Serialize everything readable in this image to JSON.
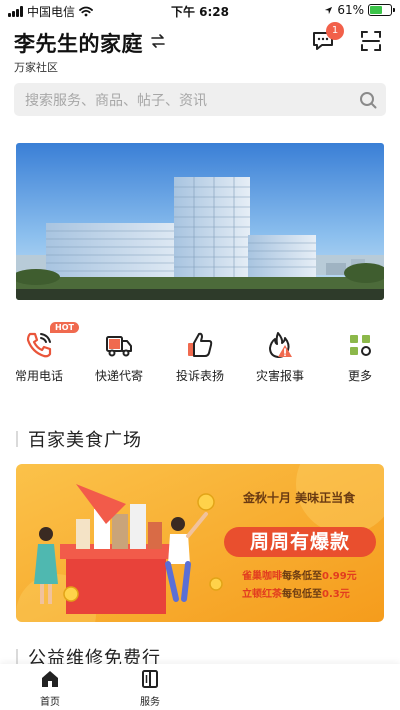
{
  "status_bar": {
    "carrier": "中国电信",
    "time": "下午 6:28",
    "battery": "61%",
    "battery_level": 0.61
  },
  "header": {
    "title": "李先生的家庭",
    "community": "万家社区",
    "message_badge": "1"
  },
  "search": {
    "placeholder": "搜索服务、商品、帖子、资讯"
  },
  "quick_menu": {
    "hot_tag": "HOT",
    "items": [
      {
        "label": "常用电话",
        "icon": "phone-icon"
      },
      {
        "label": "快递代寄",
        "icon": "delivery-truck-icon"
      },
      {
        "label": "投诉表扬",
        "icon": "thumbs-up-icon"
      },
      {
        "label": "灾害报事",
        "icon": "fire-warning-icon"
      },
      {
        "label": "更多",
        "icon": "grid-more-icon"
      }
    ]
  },
  "sections": {
    "food": "百家美食广场",
    "repair": "公益维修免费行"
  },
  "promo": {
    "slogan": "金秋十月  美味正当食",
    "headline": "周周有爆款",
    "deal1_name": "雀巢咖啡",
    "deal1_text": "每条低至",
    "deal1_price": "0.99元",
    "deal2_name": "立顿红茶",
    "deal2_text": "每包低至",
    "deal2_price": "0.3元"
  },
  "tabbar": {
    "items": [
      {
        "label": "首页"
      },
      {
        "label": "服务"
      }
    ]
  },
  "colors": {
    "accent": "#f06a4f",
    "promo_bg": "#f7a626",
    "promo_pill": "#e94f2e"
  }
}
